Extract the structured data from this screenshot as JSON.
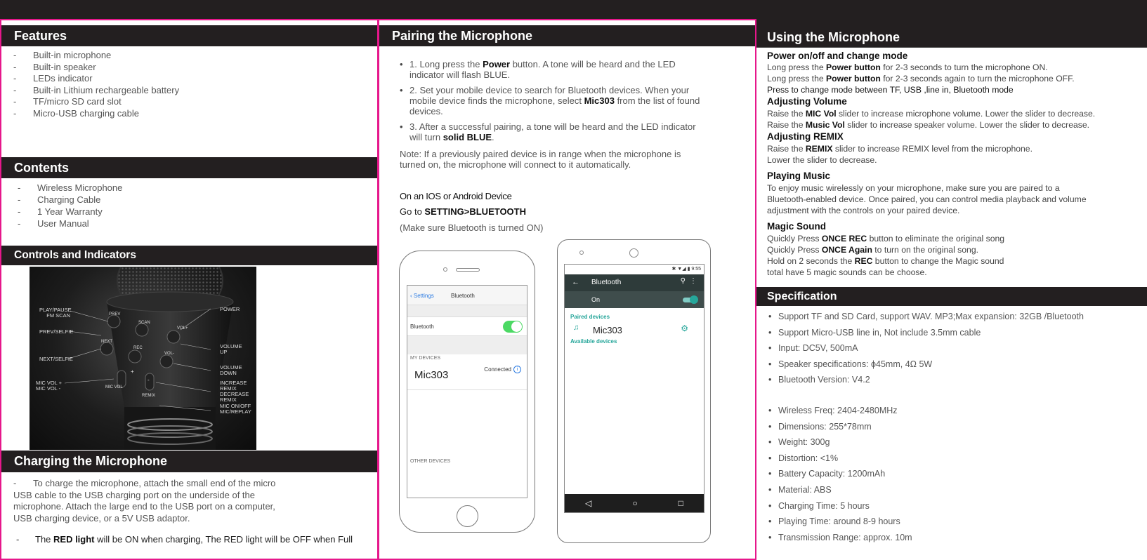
{
  "features": {
    "title": "Features",
    "items": [
      "Built-in microphone",
      "Built-in speaker",
      "LEDs indicator",
      "Built-in Lithium rechargeable battery",
      "TF/micro SD card slot",
      "Micro-USB charging cable"
    ]
  },
  "contents": {
    "title": "Contents",
    "items": [
      "Wireless Microphone",
      "Charging Cable",
      "1 Year Warranty",
      "User Manual"
    ]
  },
  "controls": {
    "title": "Controls and Indicators",
    "labels_left": [
      "PLAY/PAUSE FM SCAN",
      "PREV/SELFIE",
      "NEXT/SELFIE",
      "MIC VOL + MIC VOL -"
    ],
    "labels_right": [
      "POWER",
      "VOLUME UP",
      "VOLUME DOWN",
      "INCREASE REMIX DECREASE REMIX",
      "MIC ON/OFF MIC/REPLAY"
    ],
    "button_labels": [
      "PREV",
      "SCAN",
      "VOL+",
      "NEXT",
      "REC",
      "VOL-",
      "+",
      "-",
      "MIC VOL",
      "REMIX"
    ]
  },
  "charging": {
    "title": "Charging the Microphone",
    "para": "To charge the microphone, attach the small end of the micro USB cable to the USB charging port on the underside of the microphone. Attach the large end to the USB port on a computer, USB charging device, or a 5V USB adaptor.",
    "red_pre": "The ",
    "red_bold": "RED light",
    "red_post": " will be ON when charging, The RED light will be OFF when Full"
  },
  "pairing": {
    "title": "Pairing the Microphone",
    "s1_pre": "1. Long press the ",
    "s1_bold": "Power",
    "s1_post": " button. A tone will be heard and the LED indicator will flash BLUE.",
    "s2_pre": "2. Set your mobile device to search for Bluetooth devices. When your mobile device finds the microphone, select ",
    "s2_bold": "Mic303",
    "s2_post": " from the list of found devices.",
    "s3_pre": "3. After a successful pairing, a tone will be heard and the LED indicator will turn ",
    "s3_bold": "solid BLUE",
    "s3_post": ".",
    "note": "Note: If a previously paired device is in range when the microphone is turned on, the microphone will connect to it automatically.",
    "ios_heading": "On an IOS or Android Device",
    "goto_pre": "Go to ",
    "goto_bold": "SETTING>BLUETOOTH",
    "make_sure": "(Make sure Bluetooth is turned ON)"
  },
  "iphone": {
    "back": "Settings",
    "header": "Bluetooth",
    "bt_label": "Bluetooth",
    "my_devices": "MY DEVICES",
    "device": "Mic303",
    "status": "Connected",
    "other": "OTHER DEVICES"
  },
  "android": {
    "time": "9:55",
    "header": "Bluetooth",
    "on": "On",
    "paired": "Paired devices",
    "device": "Mic303",
    "available": "Available devices"
  },
  "using": {
    "title": "Using the Microphone",
    "power_heading": "Power on/off and change mode",
    "power_l1_pre": "Long press the ",
    "power_l1_bold": "Power button",
    "power_l1_post": " for 2-3 seconds to turn the microphone ON.",
    "power_l2_pre": "Long press the ",
    "power_l2_bold": "Power button",
    "power_l2_post": " for 2-3 seconds again to turn the microphone OFF.",
    "power_l3": "Press to change mode between TF, USB ,line in, Bluetooth mode",
    "vol_heading": "Adjusting Volume",
    "vol_l1_pre": "Raise the ",
    "vol_l1_bold": "MIC Vol",
    "vol_l1_post": " slider to increase microphone volume. Lower the slider to decrease.",
    "vol_l2_pre": "Raise the ",
    "vol_l2_bold": "Music Vol",
    "vol_l2_post": " slider to increase speaker volume. Lower the slider to decrease.",
    "remix_heading": "Adjusting REMIX",
    "remix_l1_pre": "Raise the ",
    "remix_l1_bold": "REMIX",
    "remix_l1_post": " slider to increase REMIX level from the microphone.",
    "remix_l2": "Lower the slider to decrease.",
    "music_heading": "Playing Music",
    "music_text": "To enjoy music wirelessly on your microphone, make sure you are paired to a Bluetooth-enabled device. Once paired, you can control media playback and volume adjustment with the controls on your paired device.",
    "magic_heading": "Magic Sound",
    "magic_l1_pre": "Quickly Press ",
    "magic_l1_bold": "ONCE REC",
    "magic_l1_post": " button to eliminate the original song",
    "magic_l2_pre": "Quickly Press ",
    "magic_l2_bold": "ONCE Again",
    "magic_l2_post": " to turn on the original song.",
    "magic_l3_pre": "Hold on 2 seconds the ",
    "magic_l3_bold": "REC",
    "magic_l3_post": " button to change the Magic sound",
    "magic_l4": "total have 5 magic sounds can be choose."
  },
  "spec": {
    "title": "Specification",
    "group1": [
      "Support TF and SD Card, support WAV. MP3;Max expansion: 32GB /Bluetooth",
      "Support Micro-USB line in, Not include 3.5mm cable",
      "Input: DC5V, 500mA",
      "Speaker specifications: ϕ45mm, 4Ω 5W",
      "Bluetooth Version: V4.2"
    ],
    "group2": [
      "Wireless Freq: 2404-2480MHz",
      "Dimensions: 255*78mm",
      "Weight: 300g",
      "Distortion: <1%",
      "Battery Capacity: 1200mAh",
      "Material: ABS",
      "Charging Time: 5 hours",
      "Playing Time: around 8-9 hours",
      "Transmission Range: approx. 10m"
    ]
  },
  "colors": {
    "accent": "#e6178b",
    "header_bg": "#231f20",
    "ios_toggle": "#4cd964",
    "android_teal": "#26a69a",
    "android_bar": "#2e3b3a"
  }
}
